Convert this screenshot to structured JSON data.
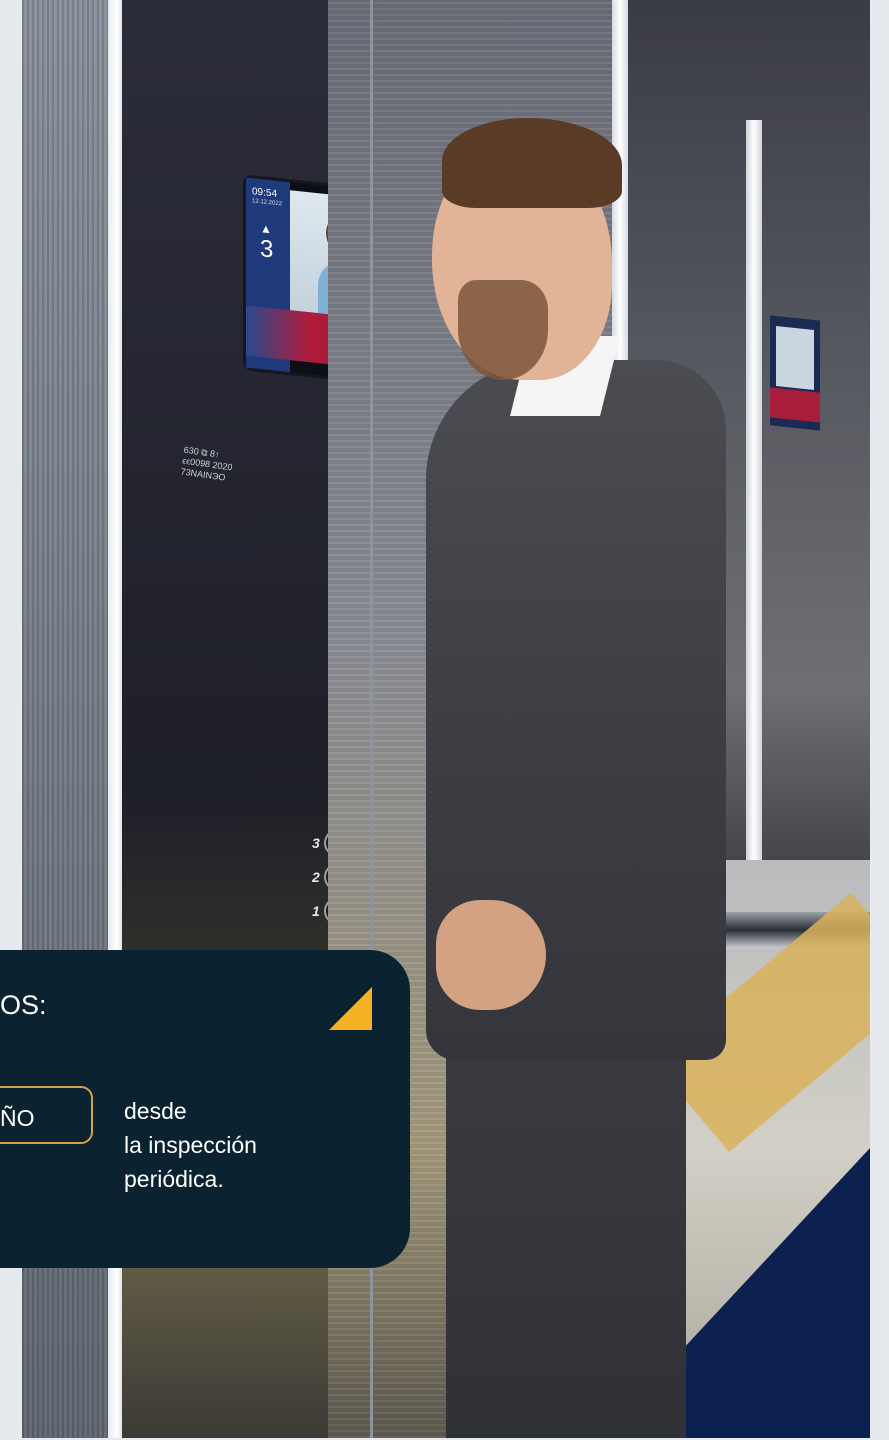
{
  "screen": {
    "time": "09:54",
    "date": "12.12.2022",
    "floor": "3"
  },
  "panel": {
    "certificate_text": "630 ⧉ 8↑\nϵϵ0098 2020\n73NAINЭO",
    "buttons": [
      "3",
      "2",
      "1"
    ]
  },
  "card": {
    "heading": "OS:",
    "pill_text": "ÑO",
    "description": "desde\nla inspección\nperiódica."
  },
  "colors": {
    "card_bg": "#0b2230",
    "accent_yellow": "#f3b324",
    "pill_border": "#d7a14a",
    "navy": "#0d2150",
    "gold": "#d9b15a"
  }
}
